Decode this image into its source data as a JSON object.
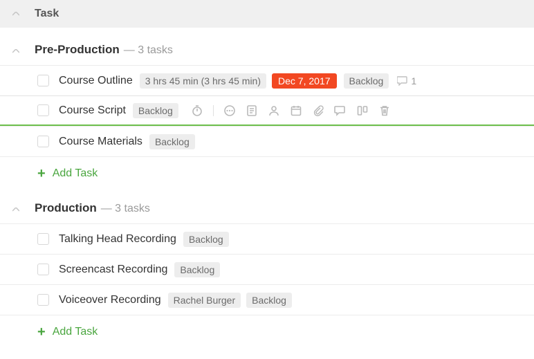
{
  "header": {
    "title": "Task"
  },
  "sections": [
    {
      "title": "Pre-Production",
      "meta": "— 3 tasks",
      "add_label": "Add Task",
      "tasks": [
        {
          "title": "Course Outline",
          "time": "3 hrs 45 min (3 hrs 45 min)",
          "date": "Dec 7, 2017",
          "status": "Backlog",
          "comments": "1"
        },
        {
          "title": "Course Script",
          "status": "Backlog",
          "selected": true
        },
        {
          "title": "Course Materials",
          "status": "Backlog"
        }
      ]
    },
    {
      "title": "Production",
      "meta": "— 3 tasks",
      "add_label": "Add Task",
      "tasks": [
        {
          "title": "Talking Head Recording",
          "status": "Backlog"
        },
        {
          "title": "Screencast Recording",
          "status": "Backlog"
        },
        {
          "title": "Voiceover Recording",
          "assignee": "Rachel Burger",
          "status": "Backlog"
        }
      ]
    }
  ]
}
